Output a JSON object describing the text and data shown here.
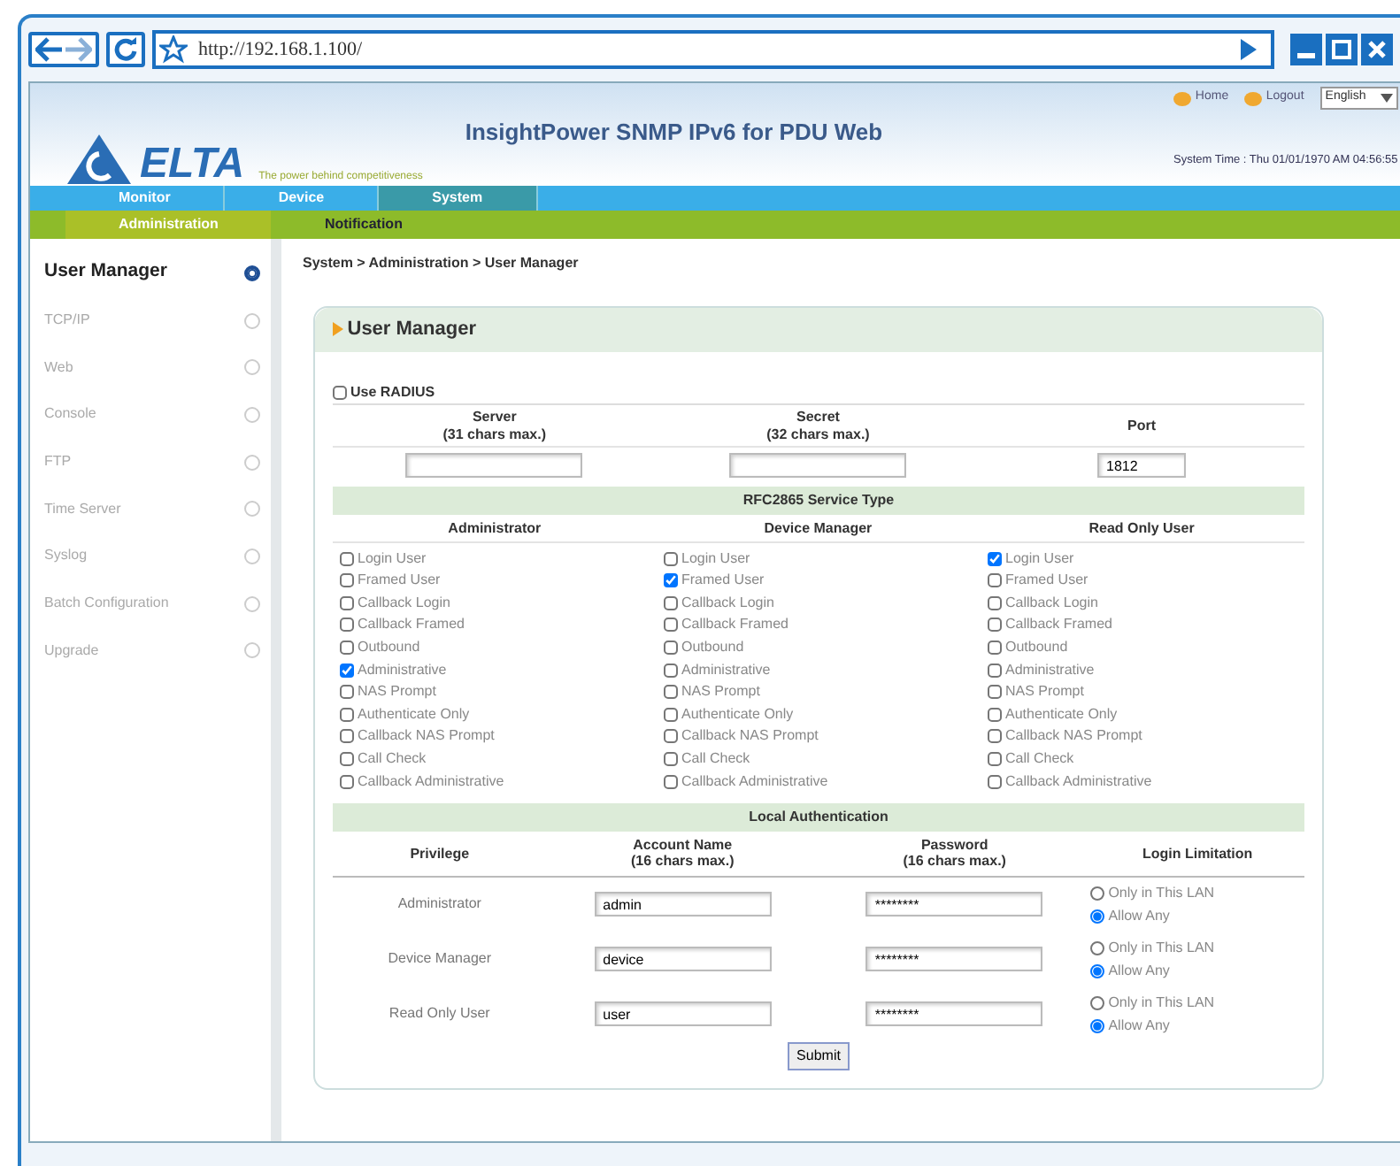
{
  "browser": {
    "url": "http://192.168.1.100/"
  },
  "header": {
    "logo_text": "ELTA",
    "tagline": "The power behind competitiveness",
    "title": "InsightPower SNMP IPv6 for PDU Web",
    "links": [
      "Home",
      "Logout"
    ],
    "language": "English",
    "system_time": "System Time : Thu 01/01/1970 AM 04:56:55"
  },
  "nav": [
    {
      "label": "Monitor",
      "selected": false
    },
    {
      "label": "Device",
      "selected": false
    },
    {
      "label": "System",
      "selected": true
    }
  ],
  "subnav": [
    {
      "label": "Administration",
      "selected": true
    },
    {
      "label": "Notification",
      "selected": false
    }
  ],
  "sidebar": {
    "items": [
      {
        "label": "User Manager",
        "selected": true
      },
      {
        "label": "TCP/IP",
        "selected": false
      },
      {
        "label": "Web",
        "selected": false
      },
      {
        "label": "Console",
        "selected": false
      },
      {
        "label": "FTP",
        "selected": false
      },
      {
        "label": "Time Server",
        "selected": false
      },
      {
        "label": "Syslog",
        "selected": false
      },
      {
        "label": "Batch Configuration",
        "selected": false
      },
      {
        "label": "Upgrade",
        "selected": false
      }
    ]
  },
  "breadcrumb": "System > Administration > User Manager",
  "panel": {
    "title": "User Manager",
    "radius": {
      "label": "Use RADIUS",
      "checked": false,
      "columns": [
        {
          "title": "Server",
          "hint": "(31 chars max.)"
        },
        {
          "title": "Secret",
          "hint": "(32 chars max.)"
        },
        {
          "title": "Port",
          "value": "1812"
        }
      ]
    },
    "services": {
      "title": "RFC2865 Service Type",
      "columns": [
        {
          "name": "Administrator",
          "options": [
            {
              "label": "Login User",
              "checked": false
            },
            {
              "label": "Framed User",
              "checked": false
            },
            {
              "label": "Callback Login",
              "checked": false
            },
            {
              "label": "Callback Framed",
              "checked": false
            },
            {
              "label": "Outbound",
              "checked": false
            },
            {
              "label": "Administrative",
              "checked": true
            },
            {
              "label": "NAS Prompt",
              "checked": false
            },
            {
              "label": "Authenticate Only",
              "checked": false
            },
            {
              "label": "Callback NAS Prompt",
              "checked": false
            },
            {
              "label": "Call Check",
              "checked": false
            },
            {
              "label": "Callback Administrative",
              "checked": false
            }
          ]
        },
        {
          "name": "Device Manager",
          "options": [
            {
              "label": "Login User",
              "checked": false
            },
            {
              "label": "Framed User",
              "checked": true
            },
            {
              "label": "Callback Login",
              "checked": false
            },
            {
              "label": "Callback Framed",
              "checked": false
            },
            {
              "label": "Outbound",
              "checked": false
            },
            {
              "label": "Administrative",
              "checked": false
            },
            {
              "label": "NAS Prompt",
              "checked": false
            },
            {
              "label": "Authenticate Only",
              "checked": false
            },
            {
              "label": "Callback NAS Prompt",
              "checked": false
            },
            {
              "label": "Call Check",
              "checked": false
            },
            {
              "label": "Callback Administrative",
              "checked": false
            }
          ]
        },
        {
          "name": "Read Only User",
          "options": [
            {
              "label": "Login User",
              "checked": true
            },
            {
              "label": "Framed User",
              "checked": false
            },
            {
              "label": "Callback Login",
              "checked": false
            },
            {
              "label": "Callback Framed",
              "checked": false
            },
            {
              "label": "Outbound",
              "checked": false
            },
            {
              "label": "Administrative",
              "checked": false
            },
            {
              "label": "NAS Prompt",
              "checked": false
            },
            {
              "label": "Authenticate Only",
              "checked": false
            },
            {
              "label": "Callback NAS Prompt",
              "checked": false
            },
            {
              "label": "Call Check",
              "checked": false
            },
            {
              "label": "Callback Administrative",
              "checked": false
            }
          ]
        }
      ]
    },
    "local_auth": {
      "title": "Local Authentication",
      "headers": [
        {
          "title": "Privilege"
        },
        {
          "title": "Account Name",
          "hint": "(16 chars max.)"
        },
        {
          "title": "Password",
          "hint": "(16 chars max.)"
        },
        {
          "title": "Login Limitation"
        }
      ],
      "rows": [
        {
          "privilege": "Administrator",
          "account": "admin",
          "password": "********",
          "options": [
            {
              "label": "Only in This LAN",
              "selected": false
            },
            {
              "label": "Allow Any",
              "selected": true
            }
          ]
        },
        {
          "privilege": "Device Manager",
          "account": "device",
          "password": "********",
          "options": [
            {
              "label": "Only in This LAN",
              "selected": false
            },
            {
              "label": "Allow Any",
              "selected": true
            }
          ]
        },
        {
          "privilege": "Read Only User",
          "account": "user",
          "password": "********",
          "options": [
            {
              "label": "Only in This LAN",
              "selected": false
            },
            {
              "label": "Allow Any",
              "selected": true
            }
          ]
        }
      ]
    },
    "submit": "Submit"
  }
}
